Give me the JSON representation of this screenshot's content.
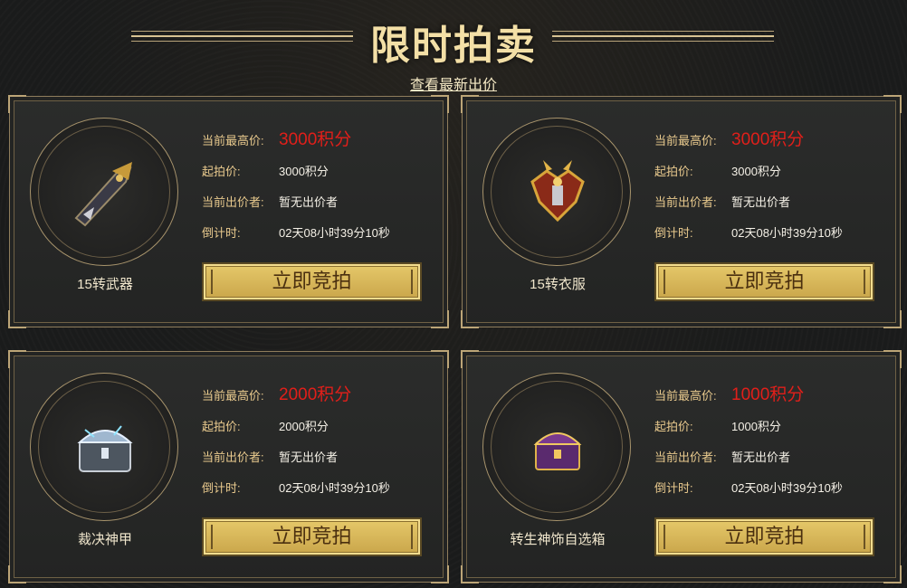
{
  "header": {
    "title": "限时拍卖",
    "link": "查看最新出价"
  },
  "labels": {
    "current_highest": "当前最高价:",
    "start_price": "起拍价:",
    "current_bidder": "当前出价者:",
    "countdown": "倒计时:",
    "bid_button": "立即竞拍"
  },
  "cards": [
    {
      "name": "15转武器",
      "highest": "3000积分",
      "start": "3000积分",
      "bidder": "暂无出价者",
      "countdown": "02天08小时39分10秒",
      "icon": "weapon-icon"
    },
    {
      "name": "15转衣服",
      "highest": "3000积分",
      "start": "3000积分",
      "bidder": "暂无出价者",
      "countdown": "02天08小时39分10秒",
      "icon": "armor-icon"
    },
    {
      "name": "裁决神甲",
      "highest": "2000积分",
      "start": "2000积分",
      "bidder": "暂无出价者",
      "countdown": "02天08小时39分10秒",
      "icon": "chest-icon"
    },
    {
      "name": "转生神饰自选箱",
      "highest": "1000积分",
      "start": "1000积分",
      "bidder": "暂无出价者",
      "countdown": "02天08小时39分10秒",
      "icon": "ornament-box-icon"
    }
  ],
  "colors": {
    "price_highlight": "#e11f1a",
    "label_gold": "#e8c98d",
    "button_gold": "#d8b95a"
  }
}
